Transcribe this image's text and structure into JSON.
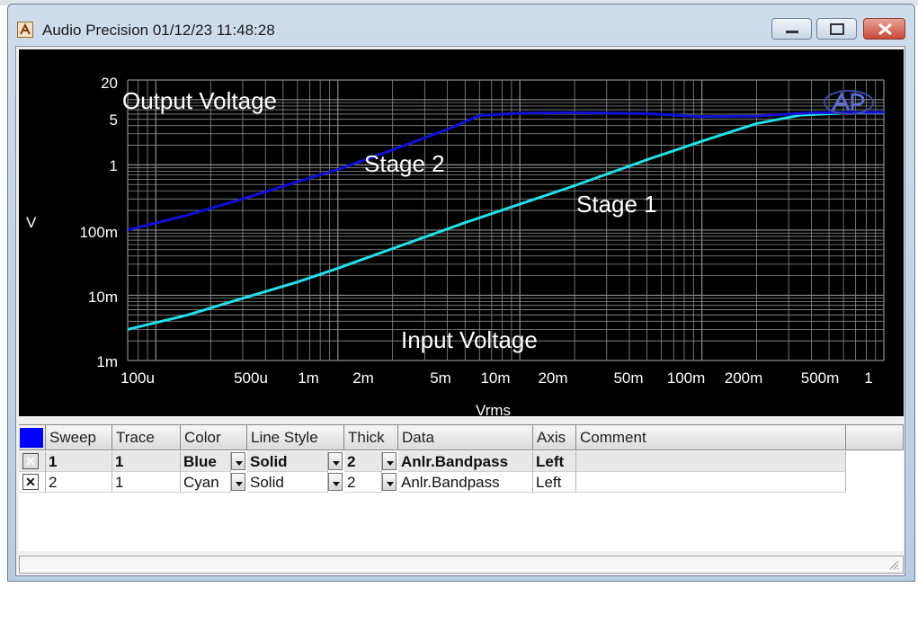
{
  "window": {
    "title": "Audio Precision  01/12/23 11:48:28"
  },
  "plot": {
    "y_axis_label": "V",
    "x_axis_label": "Vrms",
    "y_ticks": [
      "20",
      "5",
      "1",
      "100m",
      "10m",
      "1m"
    ],
    "x_ticks": [
      "100u",
      "500u",
      "1m",
      "2m",
      "5m",
      "10m",
      "20m",
      "50m",
      "100m",
      "200m",
      "500m",
      "1"
    ],
    "annotations": [
      "Output Voltage",
      "Stage 2",
      "Stage 1",
      "Input Voltage"
    ],
    "colors": {
      "background": "#000000",
      "grid": "#8c8c8c",
      "trace1": "#1010d8",
      "trace2": "#22e0e8",
      "text": "#ffffff"
    }
  },
  "table": {
    "headers": [
      "Sweep",
      "Trace",
      "Color",
      "Line Style",
      "Thick",
      "Data",
      "Axis",
      "Comment"
    ],
    "rows": [
      {
        "sweep": "1",
        "trace": "1",
        "color": "Blue",
        "line_style": "Solid",
        "thick": "2",
        "data": "Anlr.Bandpass",
        "axis": "Left",
        "comment": ""
      },
      {
        "sweep": "2",
        "trace": "1",
        "color": "Cyan",
        "line_style": "Solid",
        "thick": "2",
        "data": "Anlr.Bandpass",
        "axis": "Left",
        "comment": ""
      }
    ]
  }
}
